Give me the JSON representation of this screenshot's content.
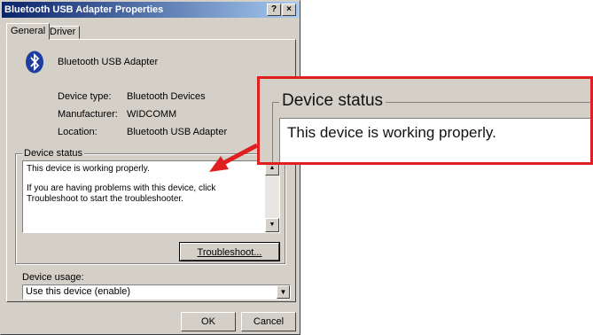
{
  "window": {
    "title": "Bluetooth USB Adapter Properties",
    "help_label": "?",
    "close_label": "×"
  },
  "tabs": [
    "General",
    "Driver"
  ],
  "device": {
    "icon": "bluetooth-icon",
    "name": "Bluetooth USB Adapter"
  },
  "properties": [
    {
      "label": "Device type:",
      "value": "Bluetooth Devices"
    },
    {
      "label": "Manufacturer:",
      "value": "WIDCOMM"
    },
    {
      "label": "Location:",
      "value": "Bluetooth USB Adapter"
    }
  ],
  "status": {
    "group_title": "Device status",
    "line1": "This device is working properly.",
    "line2": "If you are having problems with this device, click Troubleshoot to start the troubleshooter."
  },
  "troubleshoot_label": "Troubleshoot...",
  "usage": {
    "label": "Device usage:",
    "selected": "Use this device (enable)"
  },
  "buttons": {
    "ok": "OK",
    "cancel": "Cancel"
  },
  "zoom": {
    "group_title": "Device status",
    "text": "This device is working properly."
  },
  "colors": {
    "title_bar": "#0a246a",
    "callout": "#e02020",
    "bluetooth": "#1e3fa0"
  }
}
